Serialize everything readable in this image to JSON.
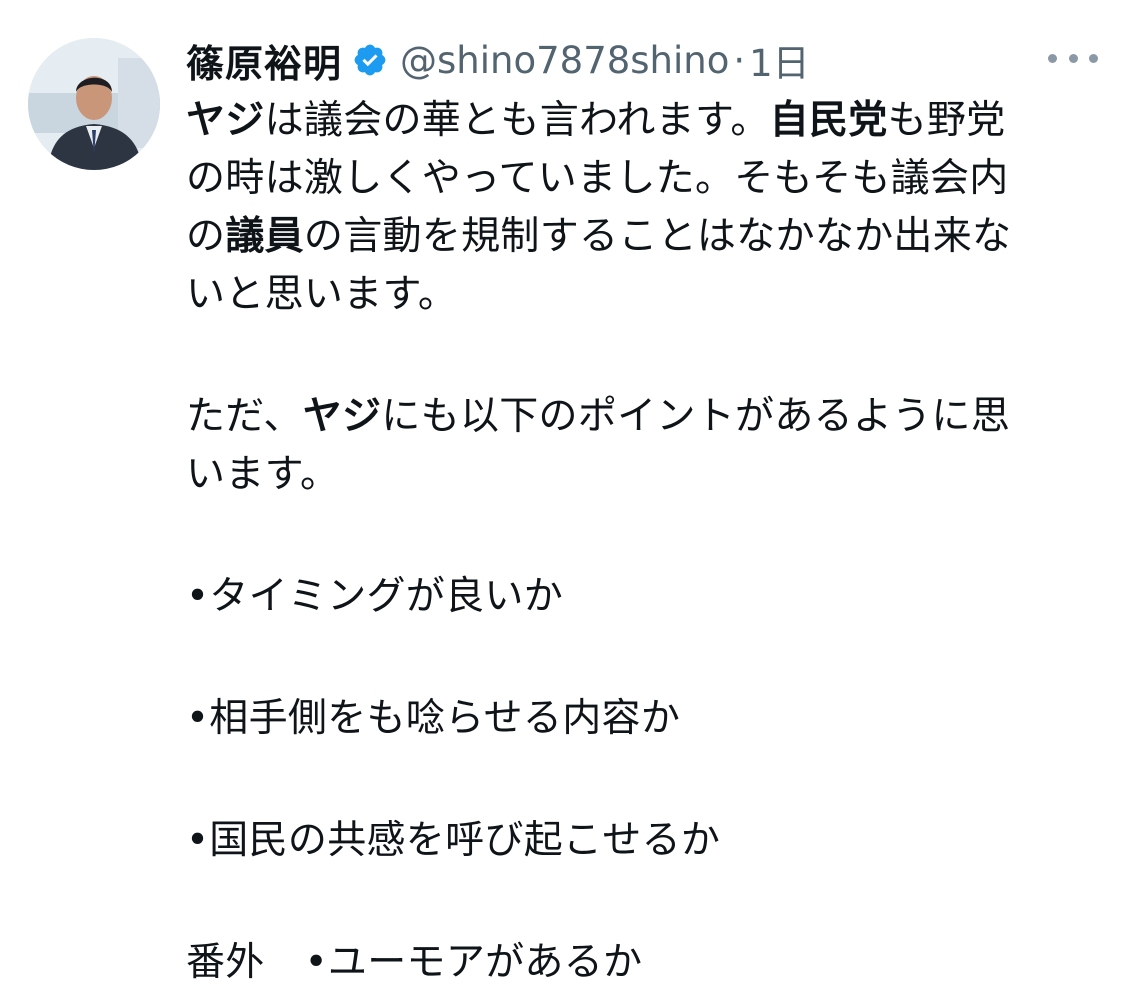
{
  "author": {
    "name": "篠原裕明",
    "handle": "@shino7878shino",
    "separator": "·",
    "time": "1日"
  },
  "icons": [
    "verified-badge-icon",
    "more-options-icon"
  ],
  "colors": {
    "verified": "#1d9bf0",
    "secondary_text": "#536471"
  },
  "tweet": {
    "p1": {
      "l1": {
        "a": "ヤジ",
        "b": "は議会の華とも言われます。",
        "c": "自民党",
        "d": "も野党"
      },
      "l2": "の時は激しくやっていました。そもそも議会内",
      "l3": {
        "a": "の",
        "b": "議員",
        "c": "の言動を規制することはなかなか出来な"
      },
      "l4": "いと思います。"
    },
    "p2": {
      "l1": {
        "a": "ただ、",
        "b": "ヤジ",
        "c": "にも以下のポイントがあるように思"
      },
      "l2": "います。"
    },
    "points": [
      "•タイミングが良いか",
      "•相手側をも唸らせる内容か",
      "•国民の共感を呼び起こせるか"
    ],
    "extra": {
      "label": "番外",
      "text": "•ユーモアがあるか"
    }
  }
}
